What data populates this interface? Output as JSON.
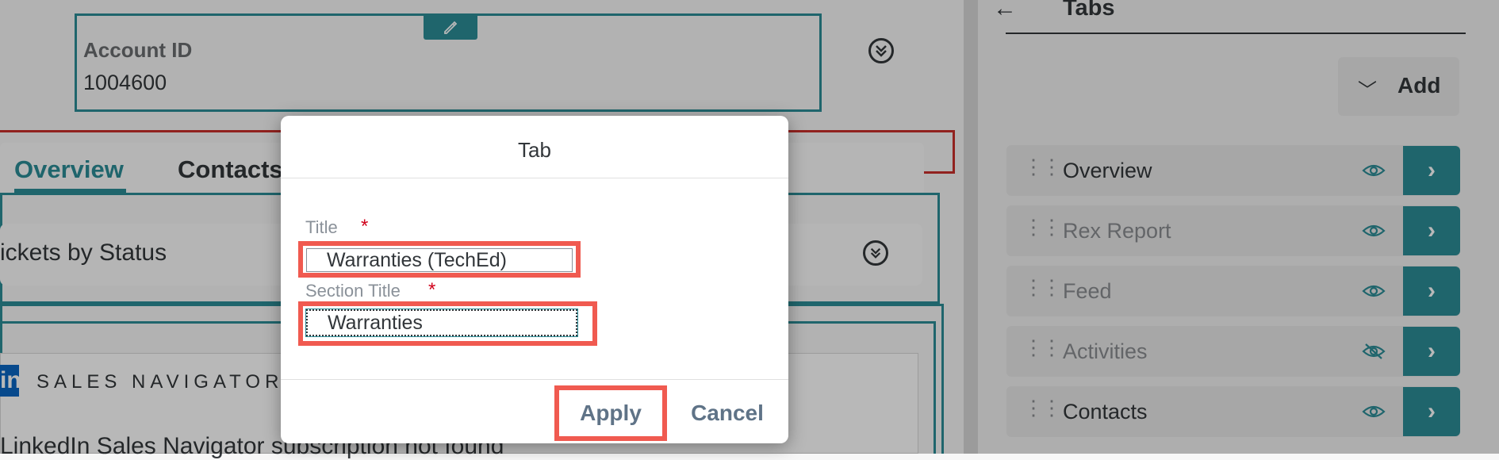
{
  "account": {
    "label": "Account ID",
    "value": "1004600",
    "edit_icon": "pencil-icon",
    "expand_icon": "double-chevron-down-icon"
  },
  "main_tabs": [
    {
      "label": "Overview",
      "selected": true
    },
    {
      "label": "Contacts",
      "selected": false
    }
  ],
  "sections": {
    "tickets_label": "ickets by Status",
    "nav_brand": "SALES NAVIGATOR",
    "nav_logo": "in",
    "nav_message": "LinkedIn Sales Navigator subscription not found"
  },
  "right_pane": {
    "back_icon": "arrow-left-icon",
    "title": "Tabs",
    "add_label": "Add",
    "add_icon": "chevron-down-icon",
    "tabs": [
      {
        "label": "Overview",
        "visible": true,
        "muted": false
      },
      {
        "label": "Rex Report",
        "visible": true,
        "muted": true
      },
      {
        "label": "Feed",
        "visible": true,
        "muted": true
      },
      {
        "label": "Activities",
        "visible": false,
        "muted": true
      },
      {
        "label": "Contacts",
        "visible": true,
        "muted": false
      }
    ]
  },
  "dialog": {
    "title": "Tab",
    "title_label": "Title",
    "title_value": "Warranties (TechEd)",
    "section_label": "Section Title",
    "section_value": "Warranties",
    "required_mark": "*",
    "apply_label": "Apply",
    "cancel_label": "Cancel"
  },
  "colors": {
    "accent": "#2b8c96",
    "highlight": "#f05a50",
    "required": "#d0021b",
    "error_outline": "#c9302c"
  }
}
